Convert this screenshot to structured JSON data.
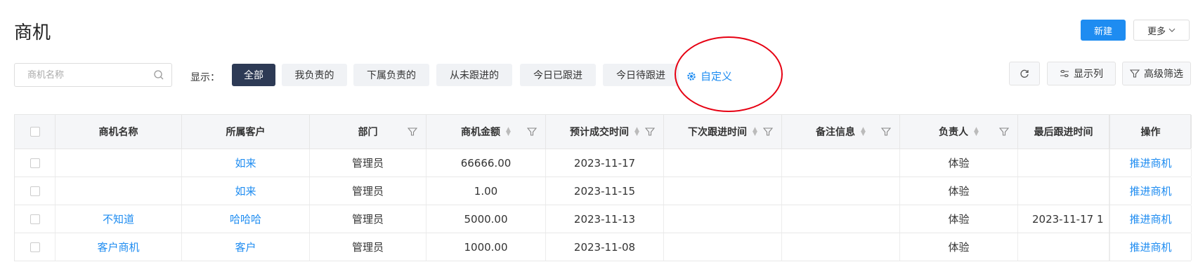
{
  "page": {
    "title": "商机"
  },
  "header": {
    "new_label": "新建",
    "more_label": "更多"
  },
  "search": {
    "placeholder": "商机名称"
  },
  "filters": {
    "label": "显示：",
    "items": [
      "全部",
      "我负责的",
      "下属负责的",
      "从未跟进的",
      "今日已跟进",
      "今日待跟进"
    ],
    "active": "全部",
    "custom_label": "自定义"
  },
  "toolbar": {
    "columns_label": "显示列",
    "advanced_label": "高级筛选"
  },
  "colors": {
    "accent": "#1e8cf1",
    "active_filter": "#2d3a55",
    "annotation": "#e60012"
  },
  "table": {
    "columns": [
      "商机名称",
      "所属客户",
      "部门",
      "商机金额",
      "预计成交时间",
      "下次跟进时间",
      "备注信息",
      "负责人",
      "最后跟进时间",
      "操作"
    ],
    "rows": [
      {
        "name": "",
        "customer": "如来",
        "dept": "管理员",
        "amount": "66666.00",
        "expected": "2023-11-17",
        "next": "",
        "remark": "",
        "owner": "体验",
        "last": "",
        "action": "推进商机"
      },
      {
        "name": "",
        "customer": "如来",
        "dept": "管理员",
        "amount": "1.00",
        "expected": "2023-11-15",
        "next": "",
        "remark": "",
        "owner": "体验",
        "last": "",
        "action": "推进商机"
      },
      {
        "name": "不知道",
        "customer": "哈哈哈",
        "dept": "管理员",
        "amount": "5000.00",
        "expected": "2023-11-13",
        "next": "",
        "remark": "",
        "owner": "体验",
        "last": "2023-11-17 1",
        "action": "推进商机"
      },
      {
        "name": "客户商机",
        "customer": "客户",
        "dept": "管理员",
        "amount": "1000.00",
        "expected": "2023-11-08",
        "next": "",
        "remark": "",
        "owner": "体验",
        "last": "",
        "action": "推进商机"
      }
    ]
  }
}
